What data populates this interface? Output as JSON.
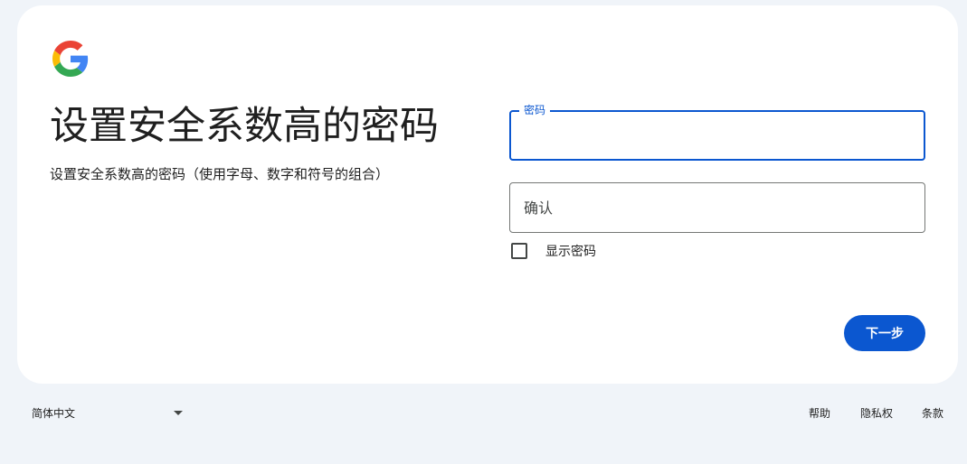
{
  "logo": {
    "icon": "google-g-logo-icon"
  },
  "heading": {
    "title": "设置安全系数高的密码",
    "subtitle": "设置安全系数高的密码（使用字母、数字和符号的组合）"
  },
  "form": {
    "password_label": "密码",
    "password_value": "",
    "confirm_placeholder": "确认",
    "confirm_value": "",
    "show_password_label": "显示密码",
    "show_password_checked": false,
    "next_label": "下一步"
  },
  "footer": {
    "language": "简体中文",
    "links": {
      "help": "帮助",
      "privacy": "隐私权",
      "terms": "条款"
    }
  },
  "colors": {
    "accent": "#0b57d0",
    "page_background": "#f0f4f9",
    "card_background": "#ffffff"
  }
}
